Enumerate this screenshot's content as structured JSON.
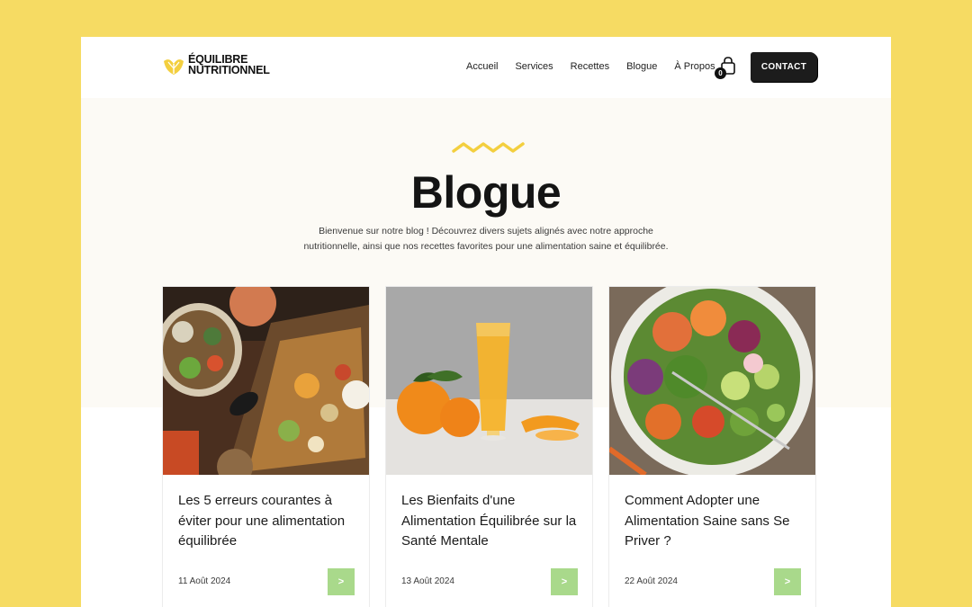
{
  "brand": {
    "line1": "ÉQUILIBRE",
    "line2": "NUTRITIONNEL"
  },
  "nav": {
    "items": [
      {
        "label": "Accueil"
      },
      {
        "label": "Services"
      },
      {
        "label": "Recettes"
      },
      {
        "label": "Blogue"
      },
      {
        "label": "À Propos"
      }
    ],
    "cart_count": "0",
    "contact_label": "CONTACT"
  },
  "hero": {
    "title": "Blogue",
    "intro": "Bienvenue sur notre blog ! Découvrez divers sujets alignés avec notre approche nutritionnelle, ainsi que nos recettes favorites pour une alimentation saine et équilibrée."
  },
  "posts": [
    {
      "title": "Les 5 erreurs courantes à éviter pour une alimentation équilibrée",
      "date": "11 Août 2024",
      "button": ">"
    },
    {
      "title": "Les Bienfaits d'une Alimentation Équilibrée sur la Santé Mentale",
      "date": "13 Août 2024",
      "button": ">"
    },
    {
      "title": "Comment Adopter une Alimentation Saine sans Se Priver ?",
      "date": "22 Août 2024",
      "button": ">"
    }
  ],
  "colors": {
    "page_background": "#f6db63",
    "accent_yellow": "#f3cf3f",
    "button_green": "#a9d98b",
    "contact_dark": "#1c1c1c",
    "hero_background": "#fcfaf5"
  }
}
